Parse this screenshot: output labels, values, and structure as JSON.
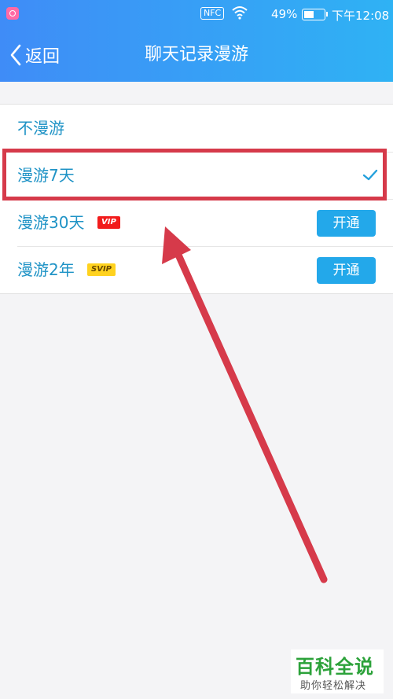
{
  "status_bar": {
    "nfc": "NFC",
    "battery_percent": "49%",
    "battery_level": 0.49,
    "time": "下午12:08"
  },
  "nav": {
    "back_label": "返回",
    "title": "聊天记录漫游"
  },
  "options": [
    {
      "label": "不漫游"
    },
    {
      "label": "漫游7天",
      "selected": true
    },
    {
      "label": "漫游30天",
      "badge": "VIP",
      "button": "开通"
    },
    {
      "label": "漫游2年",
      "badge": "SVIP",
      "button": "开通"
    }
  ],
  "colors": {
    "header_start": "#3f8cf7",
    "header_end": "#2fb2f4",
    "option_text": "#1f93c6",
    "annotation": "#d63a4a",
    "button": "#23a8ea"
  },
  "watermark": {
    "main": "百科全说",
    "sub": "助你轻松解决"
  }
}
